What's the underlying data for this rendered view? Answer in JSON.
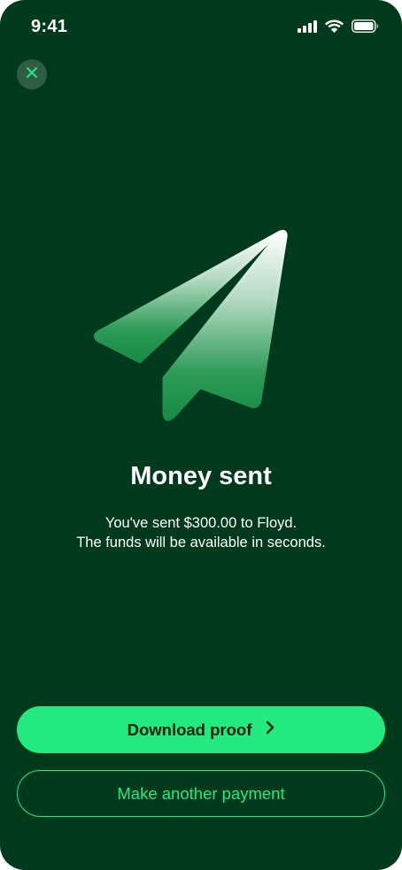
{
  "status_bar": {
    "time": "9:41",
    "icons": [
      "cellular-signal-icon",
      "wifi-icon",
      "battery-icon"
    ]
  },
  "header": {
    "close_icon": "close-icon"
  },
  "hero": {
    "icon": "paper-plane-icon"
  },
  "content": {
    "title": "Money sent",
    "message_line1": "You've sent $300.00 to Floyd.",
    "message_line2": "The funds will be available in seconds."
  },
  "actions": {
    "primary_label": "Download proof",
    "primary_icon": "chevron-right-icon",
    "secondary_label": "Make another payment"
  },
  "colors": {
    "background": "#003a1c",
    "accent": "#23ea7f",
    "text": "#ffffff"
  }
}
